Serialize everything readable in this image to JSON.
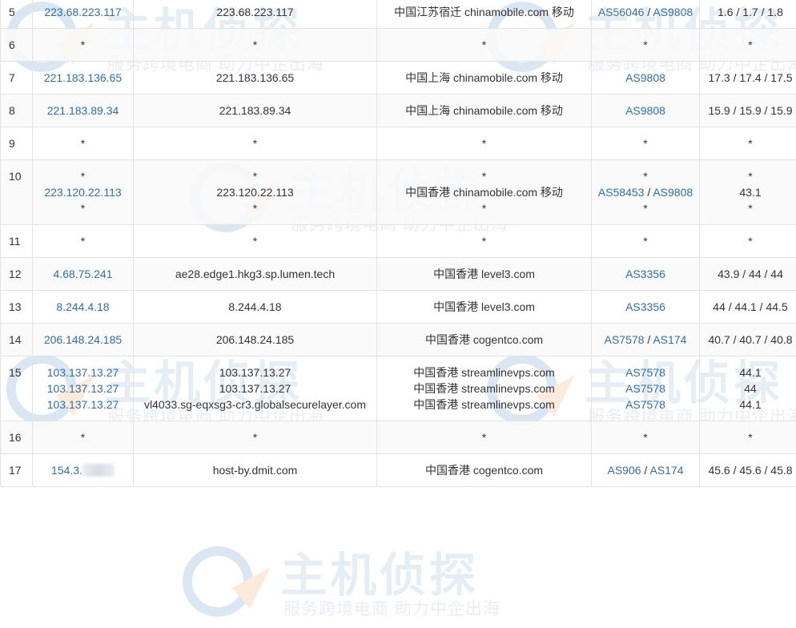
{
  "watermark": {
    "brand": "主机侦探",
    "slogan": "服务跨境电商 助力中企出海"
  },
  "rows": [
    {
      "hop": "5",
      "ip": [
        "223.68.223.117"
      ],
      "host": [
        "223.68.223.117"
      ],
      "geo": [
        "中国江苏宿迁 chinamobile.com 移动"
      ],
      "asn": [
        [
          "AS56046",
          "AS9808"
        ]
      ],
      "time": "1.6 / 1.7 / 1.8"
    },
    {
      "hop": "6",
      "ip": [
        "*"
      ],
      "host": [
        "*"
      ],
      "geo": [
        "*"
      ],
      "asn": [
        [
          "*"
        ]
      ],
      "time": "*"
    },
    {
      "hop": "7",
      "ip": [
        "221.183.136.65"
      ],
      "host": [
        "221.183.136.65"
      ],
      "geo": [
        "中国上海 chinamobile.com 移动"
      ],
      "asn": [
        [
          "AS9808"
        ]
      ],
      "time": "17.3 / 17.4 / 17.5"
    },
    {
      "hop": "8",
      "ip": [
        "221.183.89.34"
      ],
      "host": [
        "221.183.89.34"
      ],
      "geo": [
        "中国上海 chinamobile.com 移动"
      ],
      "asn": [
        [
          "AS9808"
        ]
      ],
      "time": "15.9 / 15.9 / 15.9"
    },
    {
      "hop": "9",
      "ip": [
        "*"
      ],
      "host": [
        "*"
      ],
      "geo": [
        "*"
      ],
      "asn": [
        [
          "*"
        ]
      ],
      "time": "*"
    },
    {
      "hop": "10",
      "ip": [
        "*",
        "223.120.22.113",
        "*"
      ],
      "host": [
        "*",
        "223.120.22.113",
        "*"
      ],
      "geo": [
        "*",
        "中国香港 chinamobile.com 移动",
        "*"
      ],
      "asn": [
        [
          "*"
        ],
        [
          "AS58453",
          "AS9808"
        ],
        [
          "*"
        ]
      ],
      "time": "*\n43.1\n*"
    },
    {
      "hop": "11",
      "ip": [
        "*"
      ],
      "host": [
        "*"
      ],
      "geo": [
        "*"
      ],
      "asn": [
        [
          "*"
        ]
      ],
      "time": "*"
    },
    {
      "hop": "12",
      "ip": [
        "4.68.75.241"
      ],
      "host": [
        "ae28.edge1.hkg3.sp.lumen.tech"
      ],
      "geo": [
        "中国香港 level3.com"
      ],
      "asn": [
        [
          "AS3356"
        ]
      ],
      "time": "43.9 / 44 / 44"
    },
    {
      "hop": "13",
      "ip": [
        "8.244.4.18"
      ],
      "host": [
        "8.244.4.18"
      ],
      "geo": [
        "中国香港 level3.com"
      ],
      "asn": [
        [
          "AS3356"
        ]
      ],
      "time": "44 / 44.1 / 44.5"
    },
    {
      "hop": "14",
      "ip": [
        "206.148.24.185"
      ],
      "host": [
        "206.148.24.185"
      ],
      "geo": [
        "中国香港 cogentco.com"
      ],
      "asn": [
        [
          "AS7578",
          "AS174"
        ]
      ],
      "time": "40.7 / 40.7 / 40.8"
    },
    {
      "hop": "15",
      "ip": [
        "103.137.13.27",
        "103.137.13.27",
        "103.137.13.27"
      ],
      "host": [
        "103.137.13.27",
        "103.137.13.27",
        "vl4033.sg-eqxsg3-cr3.globalsecurelayer.com"
      ],
      "geo": [
        "中国香港 streamlinevps.com",
        "中国香港 streamlinevps.com",
        "中国香港 streamlinevps.com"
      ],
      "asn": [
        [
          "AS7578"
        ],
        [
          "AS7578"
        ],
        [
          "AS7578"
        ]
      ],
      "time": "44.1\n44\n44.1"
    },
    {
      "hop": "16",
      "ip": [
        "*"
      ],
      "host": [
        "*"
      ],
      "geo": [
        "*"
      ],
      "asn": [
        [
          "*"
        ]
      ],
      "time": "*"
    },
    {
      "hop": "17",
      "ip": [
        "154.3."
      ],
      "ip_redacted": true,
      "host": [
        "host-by.dmit.com"
      ],
      "geo": [
        "中国香港 cogentco.com"
      ],
      "asn": [
        [
          "AS906",
          "AS174"
        ]
      ],
      "time": "45.6 / 45.6 / 45.8"
    }
  ]
}
